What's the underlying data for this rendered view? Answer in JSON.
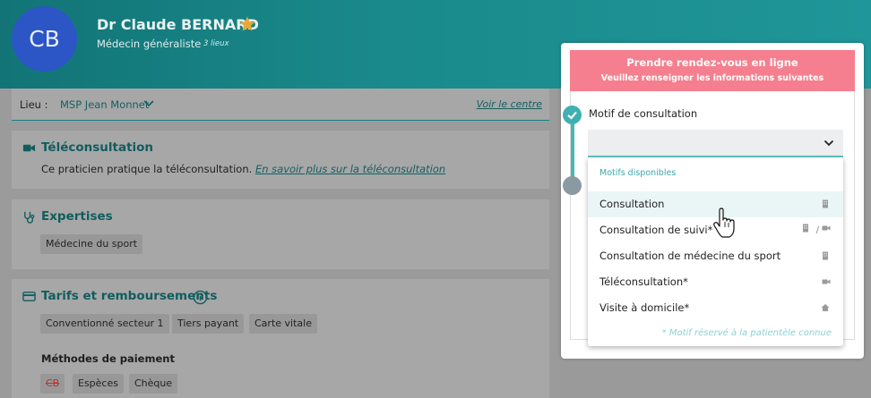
{
  "header": {
    "avatar_initials": "CB",
    "doctor_name": "Dr Claude BERNARD",
    "specialty": "Médecin généraliste",
    "locations_count": "3 lieux",
    "star_color": "#e8a838"
  },
  "location_bar": {
    "label": "Lieu :",
    "value": "MSP Jean Monnet",
    "link": "Voir le centre"
  },
  "teleconsultation": {
    "title": "Téléconsultation",
    "text": "Ce praticien pratique la téléconsultation.",
    "link": "En savoir plus sur la téléconsultation"
  },
  "expertises": {
    "title": "Expertises",
    "tags": [
      "Médecine du sport"
    ]
  },
  "tarifs": {
    "title": "Tarifs et remboursements",
    "tags": [
      "Conventionné secteur 1",
      "Tiers payant",
      "Carte vitale"
    ],
    "payment_title": "Méthodes de paiement",
    "payment_methods": [
      "CB",
      "Espèces",
      "Chèque"
    ]
  },
  "booking": {
    "title": "Prendre rendez-vous en ligne",
    "subtitle": "Veuillez renseigner les informations suivantes",
    "step_label": "Motif de consultation",
    "accent": "#3fb0b2",
    "header_color": "#f57f8e"
  },
  "dropdown": {
    "heading": "Motifs disponibles",
    "items": [
      {
        "label": "Consultation",
        "icons": [
          "building-icon"
        ]
      },
      {
        "label": "Consultation de suivi*",
        "icons": [
          "building-icon",
          "video-icon"
        ],
        "separator": "/"
      },
      {
        "label": "Consultation de médecine du sport",
        "icons": [
          "building-icon"
        ]
      },
      {
        "label": "Téléconsultation*",
        "icons": [
          "video-icon"
        ]
      },
      {
        "label": "Visite à domicile*",
        "icons": [
          "home-icon"
        ]
      }
    ],
    "note": "* Motif réservé à la patientèle connue"
  }
}
